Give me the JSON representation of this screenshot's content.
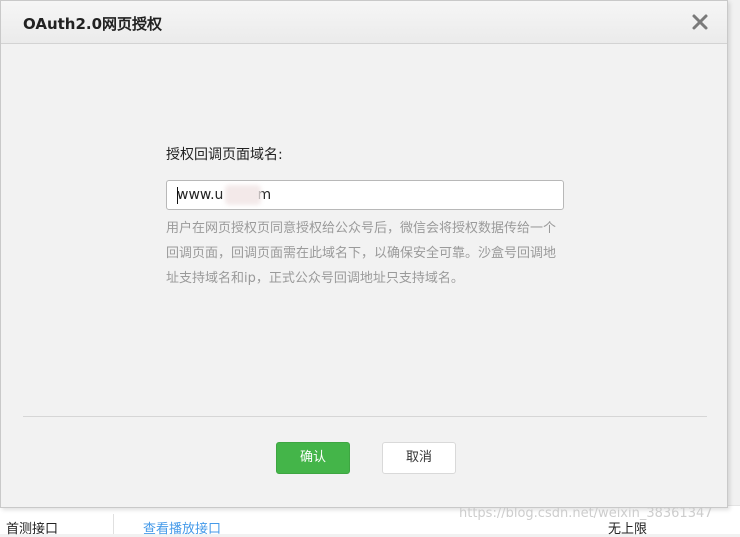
{
  "background": {
    "left_text": "首测接口",
    "link_text": "查看播放接口",
    "right_text": "无上限"
  },
  "dialog": {
    "title": "OAuth2.0网页授权",
    "close_icon": "close-icon",
    "field_label": "授权回调页面域名:",
    "domain_value": "www.u   .com",
    "help_text": "用户在网页授权页同意授权给公众号后，微信会将授权数据传给一个回调页面，回调页面需在此域名下，以确保安全可靠。沙盒号回调地址支持域名和ip，正式公众号回调地址只支持域名。",
    "confirm_label": "确认",
    "cancel_label": "取消"
  },
  "watermark": "https://blog.csdn.net/weixin_38361347",
  "colors": {
    "confirm": "#44b549",
    "help_text": "#9a9a9a"
  }
}
